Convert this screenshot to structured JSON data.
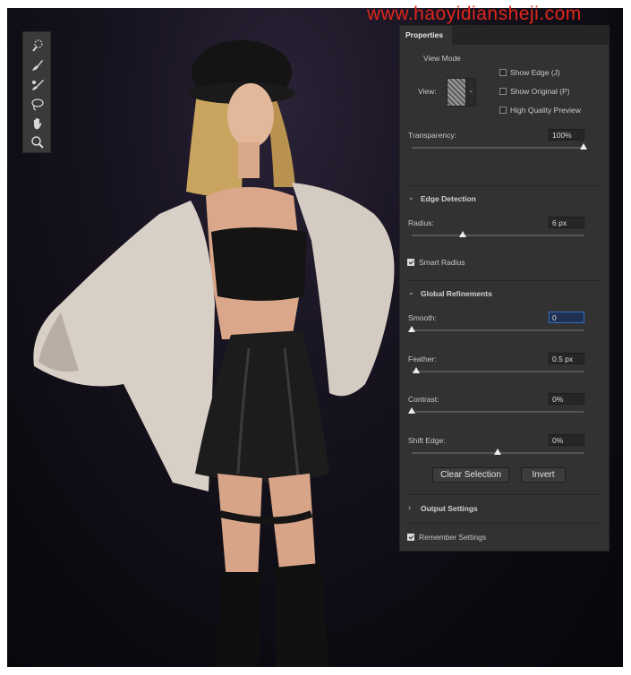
{
  "watermark": "www.haoyidiansheji.com",
  "toolbar": {
    "tools": [
      {
        "icon": "quick-selection-icon"
      },
      {
        "icon": "refine-edge-brush-icon"
      },
      {
        "icon": "brush-icon"
      },
      {
        "icon": "lasso-icon"
      },
      {
        "icon": "hand-icon"
      },
      {
        "icon": "zoom-icon"
      }
    ]
  },
  "panel": {
    "tab": "Properties",
    "view_mode": {
      "title": "View Mode",
      "view_label": "View:",
      "show_edge": {
        "label": "Show Edge (J)",
        "checked": false
      },
      "show_original": {
        "label": "Show Original (P)",
        "checked": false
      },
      "high_quality": {
        "label": "High Quality Preview",
        "checked": false
      }
    },
    "transparency": {
      "label": "Transparency:",
      "value": "100%",
      "level": 1.0
    },
    "edge_detection": {
      "title": "Edge Detection",
      "radius": {
        "label": "Radius:",
        "value": "6 px",
        "level": 0.3
      },
      "smart_radius": {
        "label": "Smart Radius",
        "checked": true
      }
    },
    "global_refinements": {
      "title": "Global Refinements",
      "smooth": {
        "label": "Smooth:",
        "value": "0",
        "level": 0.0
      },
      "feather": {
        "label": "Feather:",
        "value": "0.5 px",
        "level": 0.03
      },
      "contrast": {
        "label": "Contrast:",
        "value": "0%",
        "level": 0.0
      },
      "shift_edge": {
        "label": "Shift Edge:",
        "value": "0%",
        "level": 0.5
      }
    },
    "buttons": {
      "clear_selection": "Clear Selection",
      "invert": "Invert"
    },
    "output_settings": {
      "title": "Output Settings"
    },
    "remember_settings": {
      "label": "Remember Settings",
      "checked": true
    }
  }
}
